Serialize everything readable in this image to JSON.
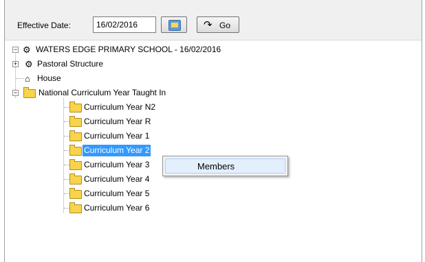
{
  "toolbar": {
    "effective_date_label": "Effective Date:",
    "effective_date_value": "16/02/2016",
    "go_label": "Go"
  },
  "tree": {
    "root": "WATERS EDGE PRIMARY SCHOOL - 16/02/2016",
    "pastoral": "Pastoral Structure",
    "house": "House",
    "national": "National Curriculum Year Taught In",
    "years": [
      "Curriculum Year N2",
      "Curriculum Year  R",
      "Curriculum Year  1",
      "Curriculum Year  2",
      "Curriculum Year  3",
      "Curriculum Year  4",
      "Curriculum Year  5",
      "Curriculum Year  6"
    ],
    "selected_index": 3
  },
  "context_menu": {
    "items": [
      "Members"
    ]
  },
  "colors": {
    "selection": "#3399ff",
    "menu_hover": "#e3effd",
    "folder": "#f8d34b"
  }
}
